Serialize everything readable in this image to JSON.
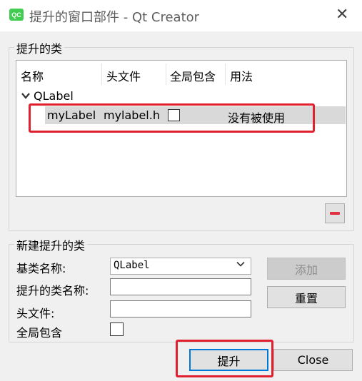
{
  "window": {
    "icon_text": "QC",
    "title": "提升的窗口部件 - Qt Creator",
    "close_glyph": "✕"
  },
  "promoted": {
    "group_title": "提升的类",
    "columns": [
      "名称",
      "头文件",
      "全局包含",
      "用法"
    ],
    "root": {
      "label": "QLabel",
      "expanded": true,
      "children": [
        {
          "name": "myLabel",
          "header": "mylabel.h",
          "global_include": false,
          "usage": "没有被使用",
          "selected": true
        }
      ]
    },
    "remove_button_icon": "minus-icon",
    "highlight_color": "#e0202e"
  },
  "new_class": {
    "group_title": "新建提升的类",
    "base_class_label": "基类名称:",
    "base_class_value": "QLabel",
    "promoted_name_label": "提升的类名称:",
    "promoted_name_value": "",
    "header_label": "头文件:",
    "header_value": "",
    "global_include_label": "全局包含",
    "global_include_checked": false,
    "add_button": "添加",
    "add_disabled": true,
    "reset_button": "重置"
  },
  "footer": {
    "promote_button": "提升",
    "close_button": "Close"
  },
  "colors": {
    "accent": "#0078d7",
    "qt_green": "#41cd52",
    "dialog_bg": "#f0f0f0"
  }
}
